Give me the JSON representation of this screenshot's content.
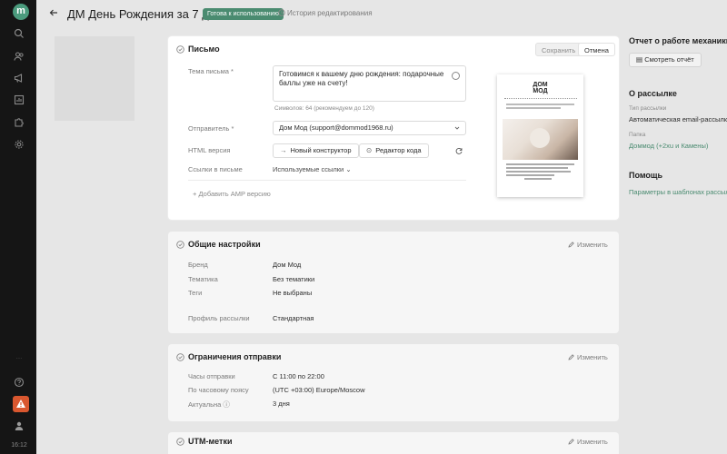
{
  "app": {
    "logo_letter": "m",
    "time": "16:12",
    "dots": "…"
  },
  "header": {
    "title": "ДМ День Рождения за 7 дней",
    "status": "Готова к использованию",
    "history": "История редактирования"
  },
  "letter": {
    "title": "Письмо",
    "save": "Сохранить",
    "cancel": "Отмена",
    "subject_label": "Тема письма *",
    "subject_value": "Готовимся к вашему дню рождения: подарочные баллы уже на счету!",
    "char_count": "Символов: 64 (рекомендуем до 120)",
    "sender_label": "Отправитель *",
    "sender_value": "Дом Мод (support@dommod1968.ru)",
    "html_label": "HTML версия",
    "new_builder": "Новый конструктор",
    "code_editor": "Редактор кода",
    "links_label": "Ссылки в письме",
    "used_links": "Используемые ссылки",
    "add_amp": "Добавить AMP версию",
    "preview_logo_line1": "ДОМ",
    "preview_logo_line2": "МОД"
  },
  "general": {
    "title": "Общие настройки",
    "edit": "Изменить",
    "rows": [
      {
        "label": "Бренд",
        "value": "Дом Мод"
      },
      {
        "label": "Тематика",
        "value": "Без тематики"
      },
      {
        "label": "Теги",
        "value": "Не выбраны"
      },
      {
        "label": "Профиль рассылки",
        "value": "Стандартная"
      }
    ]
  },
  "limits": {
    "title": "Ограничения отправки",
    "edit": "Изменить",
    "rows": [
      {
        "label": "Часы отправки",
        "value": "С 11:00 по 22:00"
      },
      {
        "label": "По часовому поясу",
        "value": "(UTC +03:00) Europe/Moscow"
      },
      {
        "label": "Актуальна",
        "value": "3 дня"
      }
    ]
  },
  "utm": {
    "title": "UTM-метки",
    "edit": "Изменить"
  },
  "right": {
    "report_title": "Отчет о работе механики",
    "report_button": "Смотреть отчёт",
    "about_title": "О рассылке",
    "type_label": "Тип рассылки",
    "type_value": "Автоматическая email-рассылка",
    "folder_label": "Папка",
    "folder_value": "Доммод (+2xu и Камены)",
    "help_title": "Помощь",
    "help_link": "Параметры в шаблонах рассылок"
  },
  "colors": {
    "accent": "#4a8b70",
    "warning": "#d9572f",
    "sidebar": "#151515"
  }
}
